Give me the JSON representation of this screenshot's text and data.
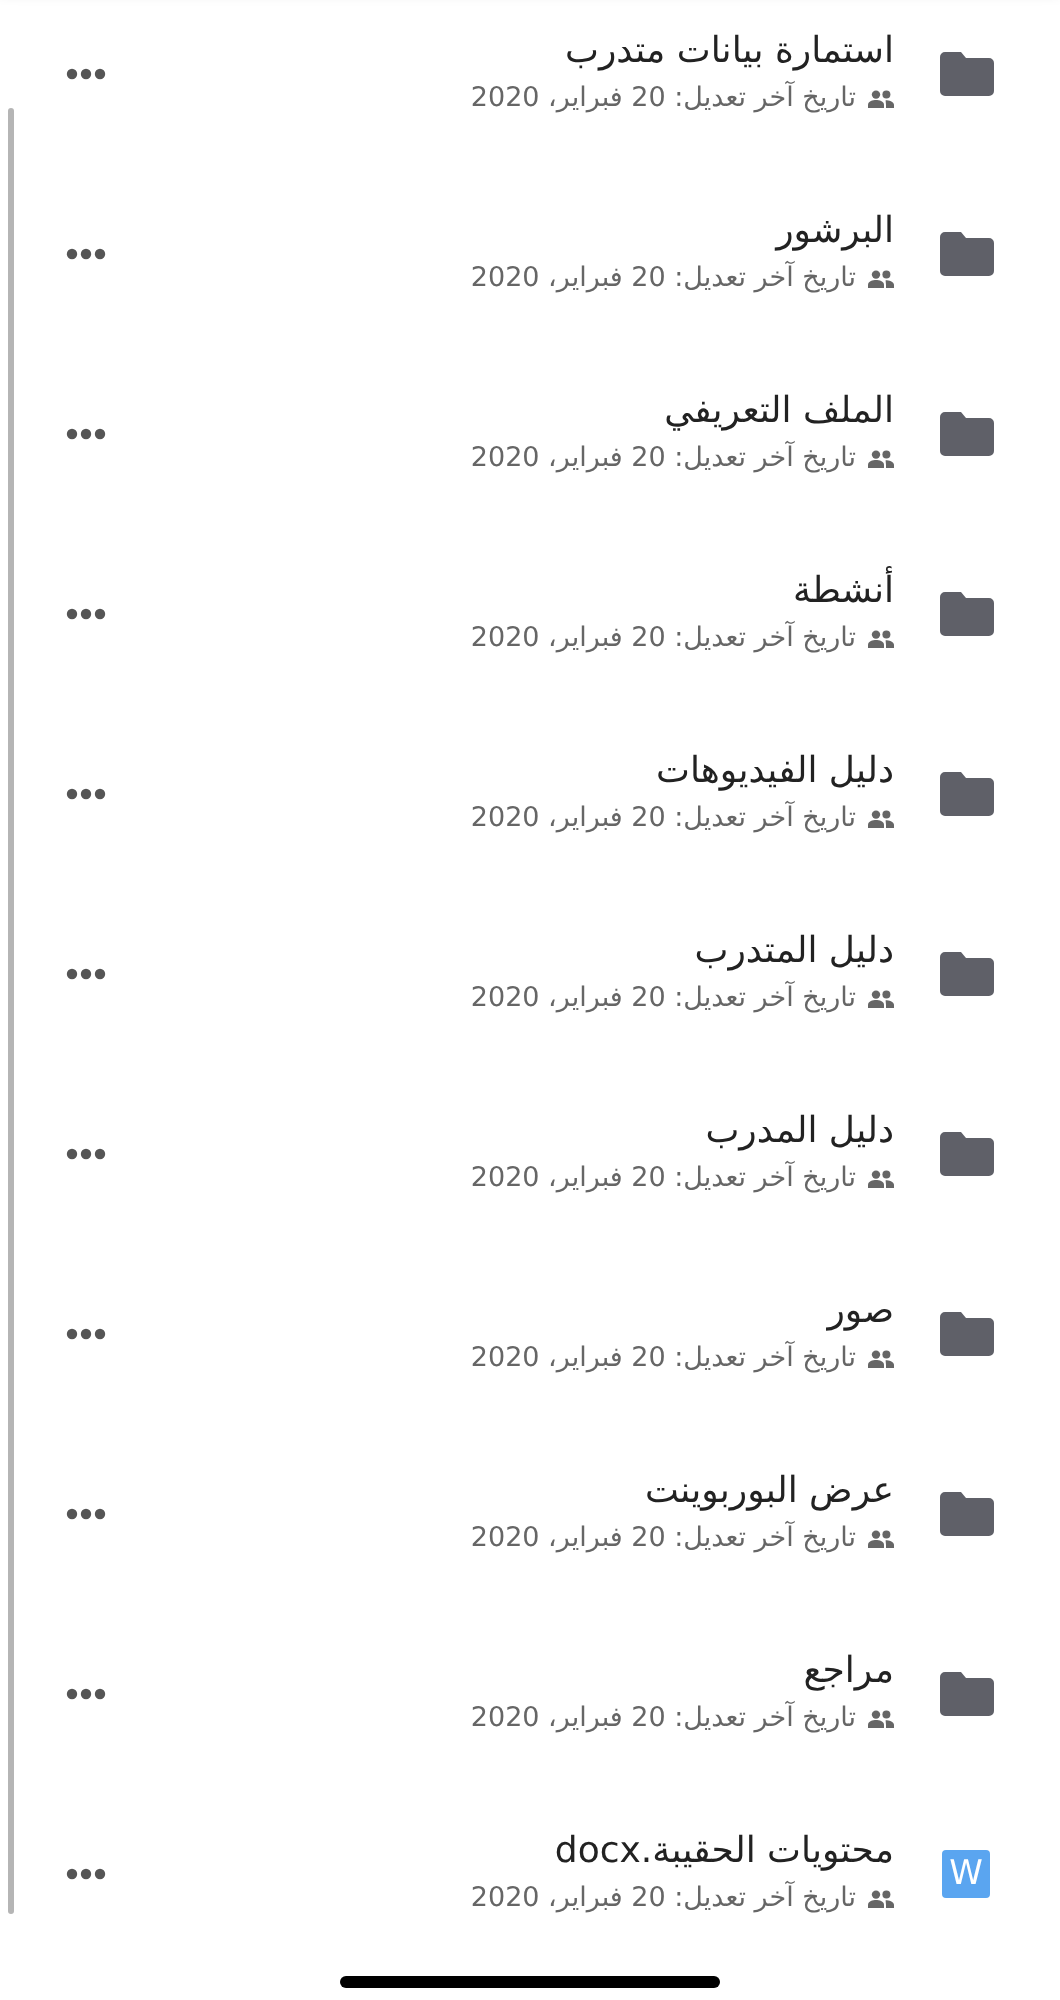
{
  "items": [
    {
      "kind": "folder",
      "name": "استمارة بيانات متدرب",
      "modified": "تاريخ آخر تعديل: 20 فبراير، 2020"
    },
    {
      "kind": "folder",
      "name": "البرشور",
      "modified": "تاريخ آخر تعديل: 20 فبراير، 2020"
    },
    {
      "kind": "folder",
      "name": "الملف التعريفي",
      "modified": "تاريخ آخر تعديل: 20 فبراير، 2020"
    },
    {
      "kind": "folder",
      "name": "أنشطة",
      "modified": "تاريخ آخر تعديل: 20 فبراير، 2020"
    },
    {
      "kind": "folder",
      "name": "دليل الفيديوهات",
      "modified": "تاريخ آخر تعديل: 20 فبراير، 2020"
    },
    {
      "kind": "folder",
      "name": "دليل المتدرب",
      "modified": "تاريخ آخر تعديل: 20 فبراير، 2020"
    },
    {
      "kind": "folder",
      "name": "دليل المدرب",
      "modified": "تاريخ آخر تعديل: 20 فبراير، 2020"
    },
    {
      "kind": "folder",
      "name": "صور",
      "modified": "تاريخ آخر تعديل: 20 فبراير، 2020"
    },
    {
      "kind": "folder",
      "name": "عرض البوربوينت",
      "modified": "تاريخ آخر تعديل: 20 فبراير، 2020"
    },
    {
      "kind": "folder",
      "name": "مراجع",
      "modified": "تاريخ آخر تعديل: 20 فبراير، 2020"
    },
    {
      "kind": "word",
      "name": "محتويات الحقيبة.docx",
      "modified": "تاريخ آخر تعديل: 20 فبراير، 2020",
      "badge": "W"
    }
  ]
}
